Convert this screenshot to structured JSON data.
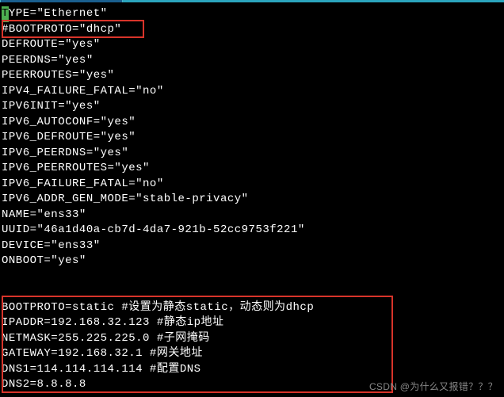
{
  "terminal": {
    "lines": [
      {
        "prefix": "T",
        "text": "YPE=\"Ethernet\"",
        "firstCharCursor": true
      },
      {
        "text": "#BOOTPROTO=\"dhcp\""
      },
      {
        "text": "DEFROUTE=\"yes\""
      },
      {
        "text": "PEERDNS=\"yes\""
      },
      {
        "text": "PEERROUTES=\"yes\""
      },
      {
        "text": "IPV4_FAILURE_FATAL=\"no\""
      },
      {
        "text": "IPV6INIT=\"yes\""
      },
      {
        "text": "IPV6_AUTOCONF=\"yes\""
      },
      {
        "text": "IPV6_DEFROUTE=\"yes\""
      },
      {
        "text": "IPV6_PEERDNS=\"yes\""
      },
      {
        "text": "IPV6_PEERROUTES=\"yes\""
      },
      {
        "text": "IPV6_FAILURE_FATAL=\"no\""
      },
      {
        "text": "IPV6_ADDR_GEN_MODE=\"stable-privacy\""
      },
      {
        "text": "NAME=\"ens33\""
      },
      {
        "text": "UUID=\"46a1d40a-cb7d-4da7-921b-52cc9753f221\""
      },
      {
        "text": "DEVICE=\"ens33\""
      },
      {
        "text": "ONBOOT=\"yes\""
      },
      {
        "text": ""
      },
      {
        "text": ""
      },
      {
        "text": "BOOTPROTO=static #设置为静态static，动态则为dhcp"
      },
      {
        "text": "IPADDR=192.168.32.123 #静态ip地址"
      },
      {
        "text": "NETMASK=255.225.225.0 #子网掩码"
      },
      {
        "text": "GATEWAY=192.168.32.1 #网关地址"
      },
      {
        "text": "DNS1=114.114.114.114 #配置DNS"
      },
      {
        "text": "DNS2=8.8.8.8"
      }
    ]
  },
  "watermark": "CSDN @为什么又报错？？？"
}
